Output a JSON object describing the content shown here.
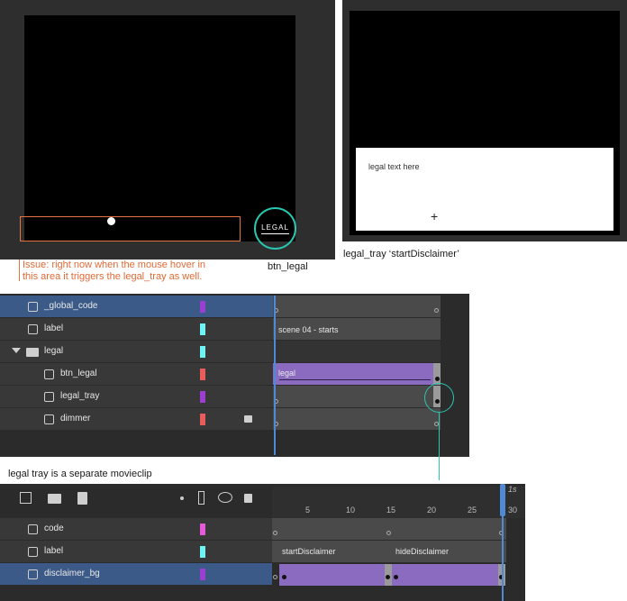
{
  "top_left": {
    "issue_note_line1": "Issue: right now when the mouse hover in",
    "issue_note_line2": "this area it triggers the legal_tray as well.",
    "button_label": "LEGAL",
    "button_caption": "btn_legal"
  },
  "top_right": {
    "tray_text": "legal text here",
    "plus": "+",
    "caption": "legal_tray ‘startDisclaimer’"
  },
  "timeline1": {
    "layers": [
      {
        "name": "_global_code",
        "color": "#9b3fd1"
      },
      {
        "name": "label",
        "color": "#6ff3f3"
      },
      {
        "name": "legal",
        "color": "#6ff3f3"
      },
      {
        "name": "btn_legal",
        "color": "#e85c5c"
      },
      {
        "name": "legal_tray",
        "color": "#9b3fd1"
      },
      {
        "name": "dimmer",
        "color": "#e85c5c"
      }
    ],
    "frame_label_1": "scene 04 - starts",
    "frame_label_2": "legal"
  },
  "middle_note": "legal tray is a separate movieclip",
  "timeline2": {
    "ruler": [
      "5",
      "10",
      "15",
      "20",
      "25",
      "30"
    ],
    "ruler_unit": "1s",
    "layers": [
      {
        "name": "code",
        "color": "#e45ad8"
      },
      {
        "name": "label",
        "color": "#6ff3f3"
      },
      {
        "name": "disclaimer_bg",
        "color": "#9b3fd1"
      }
    ],
    "frame_label_1": "startDisclaimer",
    "frame_label_2": "hideDisclaimer"
  }
}
